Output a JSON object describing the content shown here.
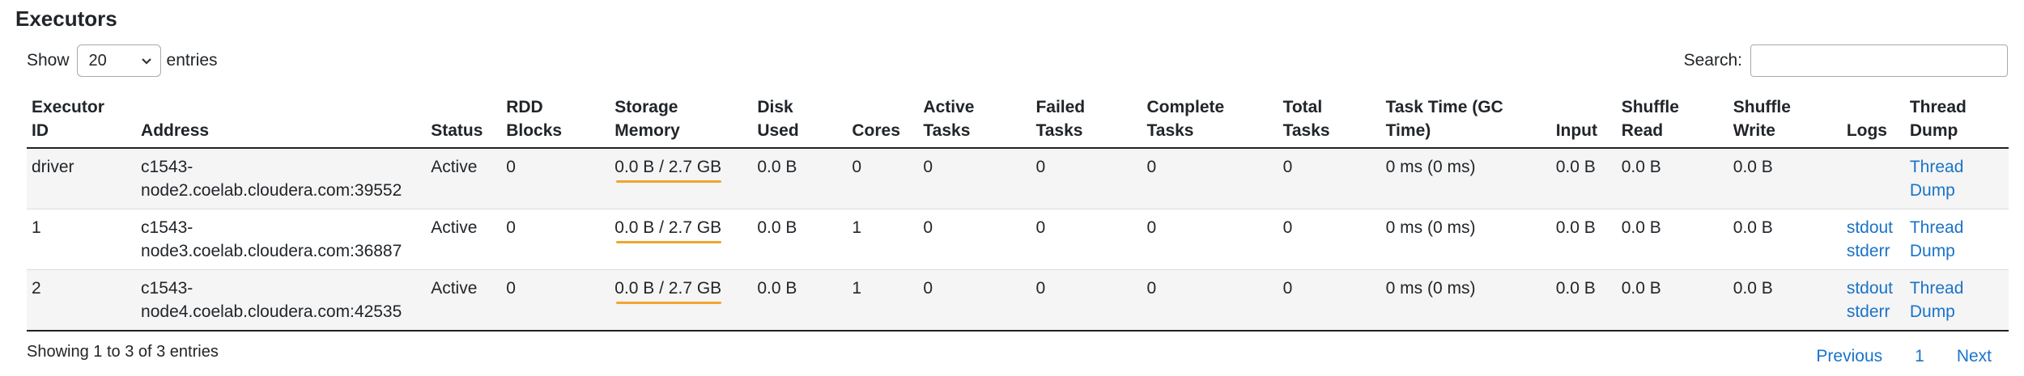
{
  "title": "Executors",
  "length_menu": {
    "show_label": "Show",
    "value": "20",
    "entries_label": "entries"
  },
  "search": {
    "label": "Search:",
    "value": ""
  },
  "columns": [
    [
      "Executor",
      "ID"
    ],
    [
      "",
      "Address"
    ],
    [
      "",
      "Status"
    ],
    [
      "RDD",
      "Blocks"
    ],
    [
      "Storage",
      "Memory"
    ],
    [
      "Disk",
      "Used"
    ],
    [
      "",
      "Cores"
    ],
    [
      "Active",
      "Tasks"
    ],
    [
      "Failed",
      "Tasks"
    ],
    [
      "Complete",
      "Tasks"
    ],
    [
      "Total",
      "Tasks"
    ],
    [
      "Task Time (GC",
      "Time)"
    ],
    [
      "",
      "Input"
    ],
    [
      "Shuffle",
      "Read"
    ],
    [
      "Shuffle",
      "Write"
    ],
    [
      "",
      "Logs"
    ],
    [
      "Thread",
      "Dump"
    ]
  ],
  "rows": [
    {
      "id": "driver",
      "address_host": "c1543-",
      "address_rest": "node2.coelab.cloudera.com:39552",
      "status": "Active",
      "rdd_blocks": "0",
      "storage_memory": "0.0 B / 2.7 GB",
      "storage_used_fraction": 0.0,
      "disk_used": "0.0 B",
      "cores": "0",
      "active_tasks": "0",
      "failed_tasks": "0",
      "complete_tasks": "0",
      "total_tasks": "0",
      "task_time": "0 ms (0 ms)",
      "input": "0.0 B",
      "shuffle_read": "0.0 B",
      "shuffle_write": "0.0 B",
      "logs_stdout": "",
      "logs_stderr": "",
      "thread_dump": "Thread Dump"
    },
    {
      "id": "1",
      "address_host": "c1543-",
      "address_rest": "node3.coelab.cloudera.com:36887",
      "status": "Active",
      "rdd_blocks": "0",
      "storage_memory": "0.0 B / 2.7 GB",
      "storage_used_fraction": 0.0,
      "disk_used": "0.0 B",
      "cores": "1",
      "active_tasks": "0",
      "failed_tasks": "0",
      "complete_tasks": "0",
      "total_tasks": "0",
      "task_time": "0 ms (0 ms)",
      "input": "0.0 B",
      "shuffle_read": "0.0 B",
      "shuffle_write": "0.0 B",
      "logs_stdout": "stdout",
      "logs_stderr": "stderr",
      "thread_dump": "Thread Dump"
    },
    {
      "id": "2",
      "address_host": "c1543-",
      "address_rest": "node4.coelab.cloudera.com:42535",
      "status": "Active",
      "rdd_blocks": "0",
      "storage_memory": "0.0 B / 2.7 GB",
      "storage_used_fraction": 0.0,
      "disk_used": "0.0 B",
      "cores": "1",
      "active_tasks": "0",
      "failed_tasks": "0",
      "complete_tasks": "0",
      "total_tasks": "0",
      "task_time": "0 ms (0 ms)",
      "input": "0.0 B",
      "shuffle_read": "0.0 B",
      "shuffle_write": "0.0 B",
      "logs_stdout": "stdout",
      "logs_stderr": "stderr",
      "thread_dump": "Thread Dump"
    }
  ],
  "footer": {
    "info": "Showing 1 to 3 of 3 entries",
    "previous": "Previous",
    "page": "1",
    "next": "Next"
  },
  "colors": {
    "link": "#1a73c8",
    "memory_bar": "#f0a530"
  },
  "icons": {
    "select_caret": "chevron-down-icon"
  }
}
